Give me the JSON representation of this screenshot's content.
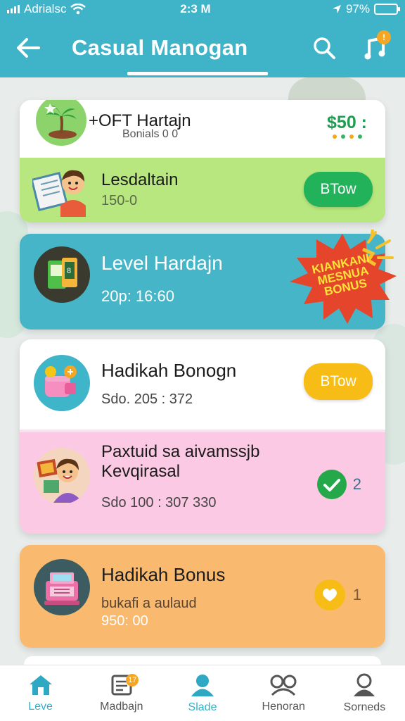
{
  "status_bar": {
    "carrier": "Adrialsc",
    "time": "2:3 M",
    "battery": "97%"
  },
  "header": {
    "title": "Casual Manogan"
  },
  "cards": {
    "card1": {
      "title": "+OFT Hartajn",
      "subtitle": "Bonials 0 0",
      "amount": "$50 :"
    },
    "card1_sub": {
      "title": "Lesdaltain",
      "value": "150-0",
      "button": "BTow"
    },
    "card2": {
      "title": "Level Hardajn",
      "value": "20p: 16:60",
      "burst_text": "KIANKANI MESNUA BONUS"
    },
    "card3": {
      "title": "Hadikah Bonogn",
      "value": "Sdo. 205 : 372",
      "button": "BTow"
    },
    "card4": {
      "title_line1": "Paxtuid sa aivamssjb",
      "title_line2": "Kevqirasal",
      "value": "Sdo 100 : 307 330",
      "count": "2"
    },
    "card5": {
      "title": "Hadikah Bonus",
      "subtitle": "bukafi a aulaud",
      "value": "950: 00",
      "count": "1"
    }
  },
  "bottom_nav": {
    "items": [
      {
        "label": "Leve",
        "icon": "home-icon",
        "active": true
      },
      {
        "label": "Madbajn",
        "icon": "document-icon",
        "badge": "17"
      },
      {
        "label": "Slade",
        "icon": "profile-icon"
      },
      {
        "label": "Henoran",
        "icon": "glasses-icon"
      },
      {
        "label": "Sorneds",
        "icon": "user-icon"
      }
    ]
  },
  "colors": {
    "header": "#3fb3c8",
    "green_card": "#b7e77e",
    "teal_card": "#46b5c8",
    "pink_card": "#fbc9e4",
    "orange_card": "#f9ba6f",
    "green_button": "#22b35a",
    "yellow_button": "#f7bd16",
    "burst": "#e5462b"
  }
}
